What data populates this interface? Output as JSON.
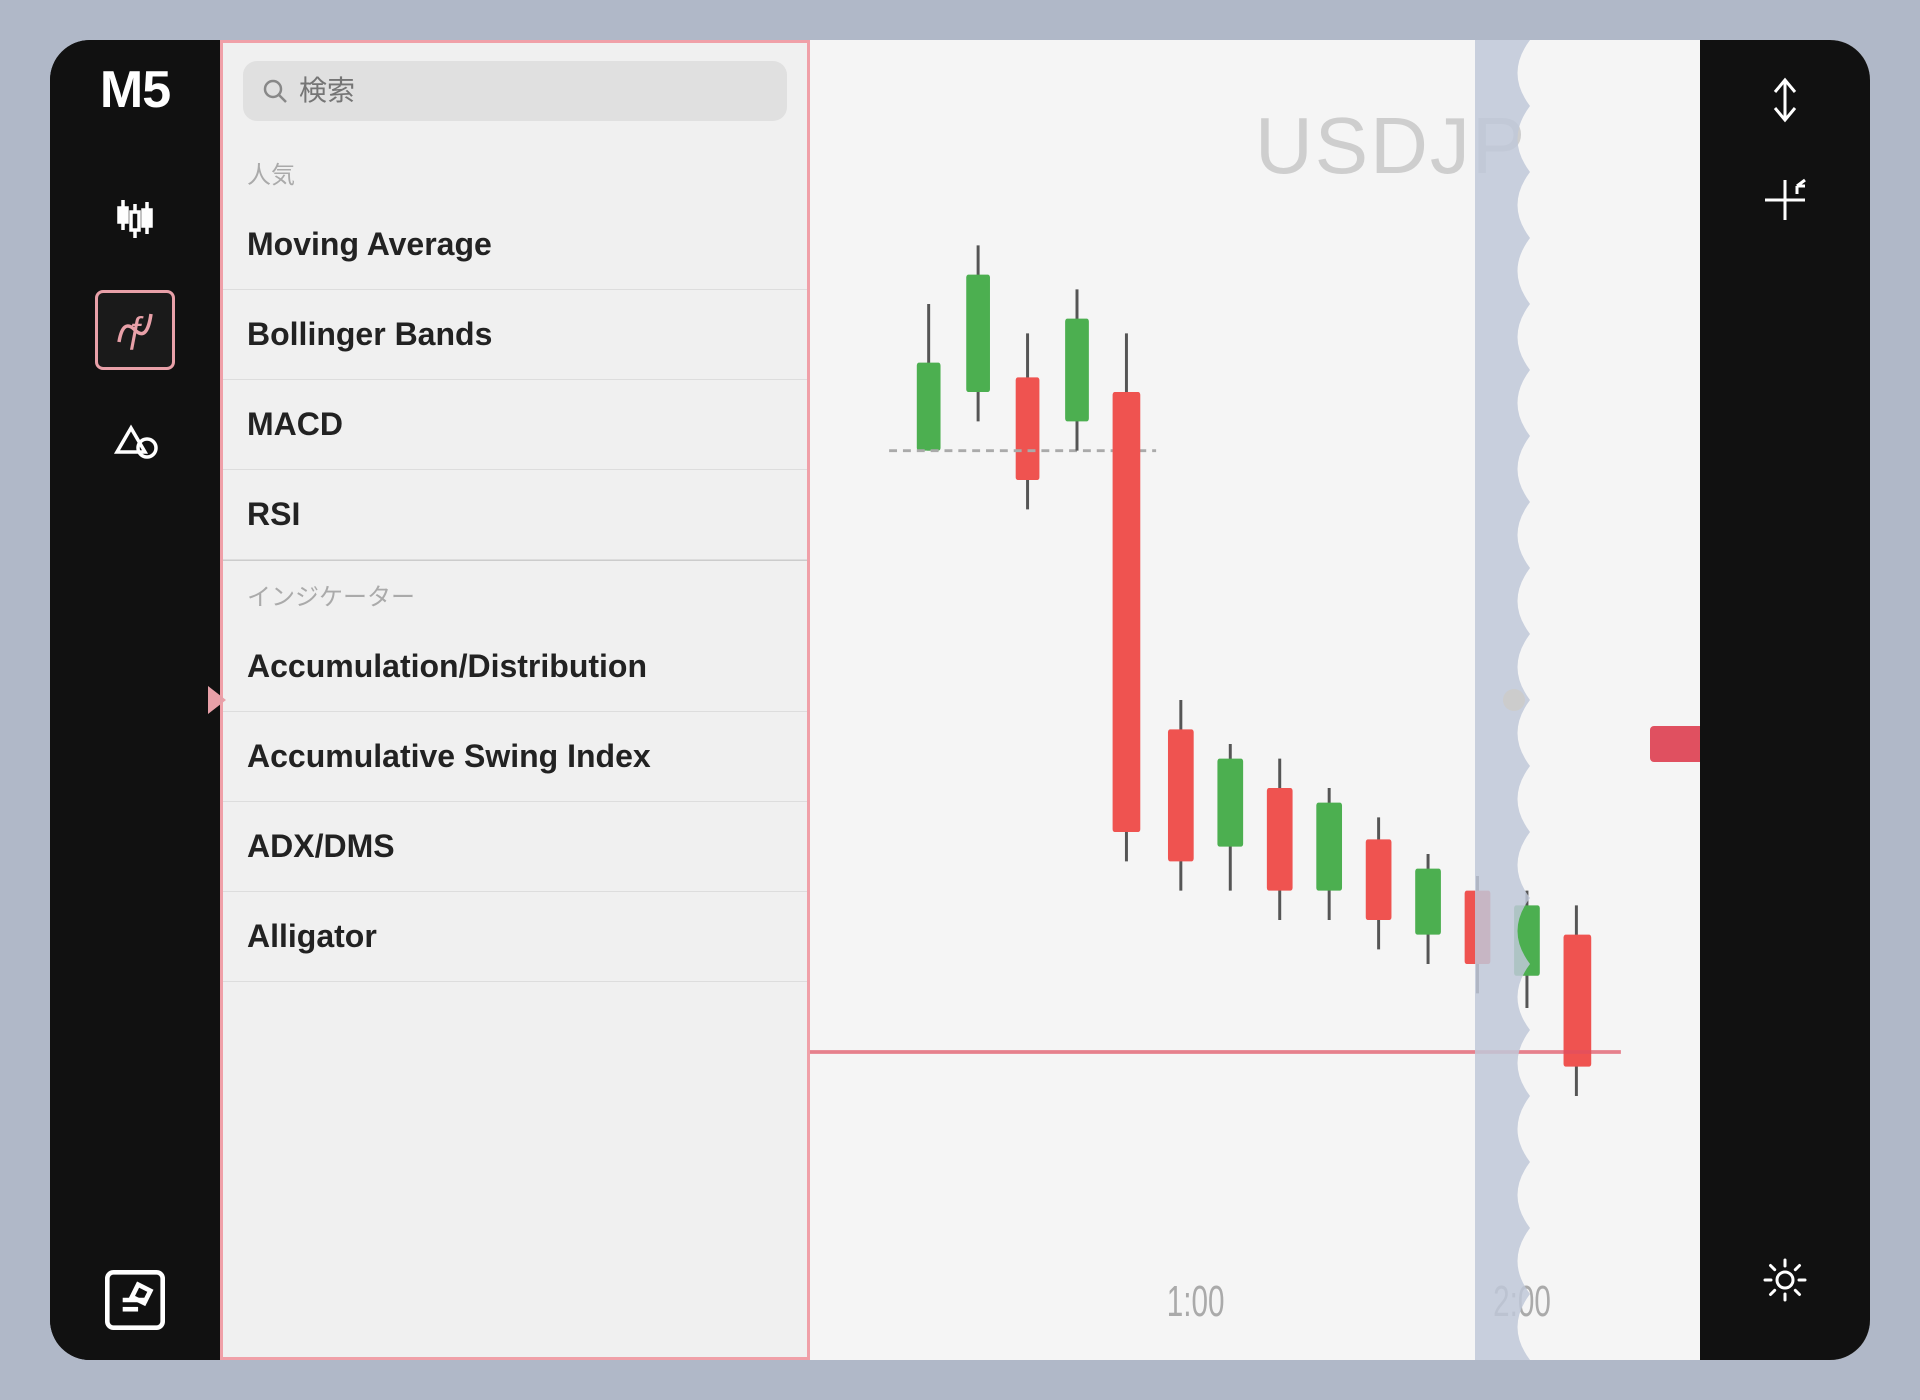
{
  "app": {
    "timeframe": "M5",
    "symbol": "USDJP"
  },
  "search": {
    "placeholder": "検索"
  },
  "sections": {
    "popular": {
      "label": "人気",
      "items": [
        {
          "id": "moving-average",
          "label": "Moving Average"
        },
        {
          "id": "bollinger-bands",
          "label": "Bollinger Bands"
        },
        {
          "id": "macd",
          "label": "MACD"
        },
        {
          "id": "rsi",
          "label": "RSI"
        }
      ]
    },
    "indicators": {
      "label": "インジケーター",
      "items": [
        {
          "id": "accumulation-distribution",
          "label": "Accumulation/Distribution"
        },
        {
          "id": "accumulative-swing-index",
          "label": "Accumulative Swing Index"
        },
        {
          "id": "adx-dms",
          "label": "ADX/DMS"
        },
        {
          "id": "alligator",
          "label": "Alligator"
        }
      ]
    }
  },
  "chart": {
    "times": [
      "1:00",
      "2:00"
    ]
  },
  "sidebar_left": {
    "logo": "M5",
    "icons": [
      {
        "id": "candlestick",
        "label": "Candlestick chart"
      },
      {
        "id": "indicators",
        "label": "Indicators",
        "active": true
      },
      {
        "id": "shapes",
        "label": "Drawing tools"
      }
    ],
    "bottom": [
      {
        "id": "edit",
        "label": "Edit"
      }
    ]
  },
  "sidebar_right": {
    "icons": [
      {
        "id": "price-scale",
        "label": "Price scale"
      },
      {
        "id": "crosshair",
        "label": "Crosshair"
      }
    ],
    "bottom": [
      {
        "id": "settings",
        "label": "Settings"
      }
    ]
  }
}
